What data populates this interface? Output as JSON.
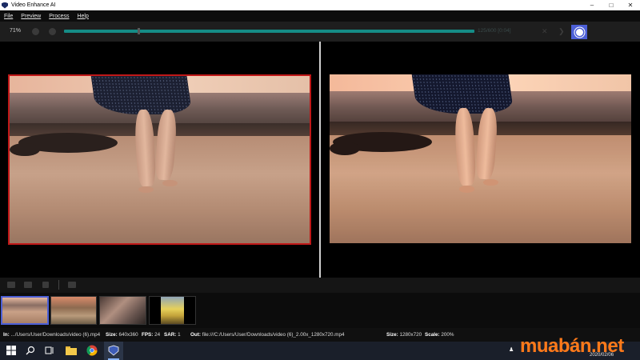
{
  "window": {
    "title": "Video Enhance AI"
  },
  "menu": [
    {
      "label": "File"
    },
    {
      "label": "Preview"
    },
    {
      "label": "Process"
    },
    {
      "label": "Help"
    }
  ],
  "toolbar": {
    "zoom": "71%",
    "frame_label": "125/600 [0:04]",
    "timeline_progress": 0.18
  },
  "status": {
    "in_label": "In:",
    "in_value": ".../Users/User/Downloads/video (6).mp4",
    "size_label": "Size:",
    "size_value": "640x360",
    "fps_label": "FPS:",
    "fps_value": "24",
    "sar_label": "SAR:",
    "sar_value": "1",
    "out_label": "Out:",
    "out_value": "file:///C:/Users/User/Downloads/video (6)_2.00x_1280x720.mp4",
    "out_size_label": "Size:",
    "out_size_value": "1280x720",
    "scale_label": "Scale:",
    "scale_value": "200%"
  },
  "taskbar": {
    "date": "2020/02/06"
  },
  "watermark": {
    "text": "muabán",
    "suffix": ".net"
  },
  "colors": {
    "accent": "#4c5fd6",
    "timeline": "#158c86",
    "selection_border": "#c01818"
  }
}
